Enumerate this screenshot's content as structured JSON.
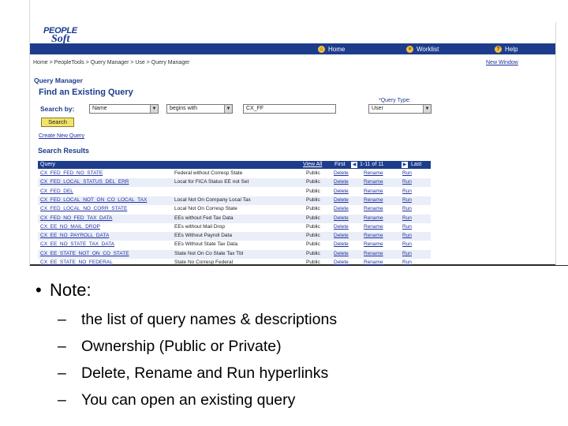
{
  "app": {
    "logo_top": "PEOPLE",
    "logo_bottom": "Soft"
  },
  "topnav": {
    "home": "Home",
    "worklist": "Worklist",
    "help": "Help"
  },
  "breadcrumb": "Home > PeopleTools > Query Manager > Use > Query Manager",
  "new_window": "New Window",
  "page": {
    "section_title": "Query Manager",
    "title": "Find an Existing Query"
  },
  "search": {
    "label": "Search by:",
    "field_value": "Name",
    "operator_value": "begins with",
    "input_value": "CX_FF",
    "query_type_label": "*Query Type:",
    "query_type_value": "User",
    "button_label": "Search",
    "create_link": "Create New Query"
  },
  "results": {
    "title": "Search Results",
    "headers": {
      "query": "Query",
      "view_all": "View All",
      "first": "First",
      "range": "1-11 of 11",
      "last": "Last"
    },
    "rows": [
      {
        "name": "CX_FED_FED_NO_STATE",
        "desc": "Federal without Corresp State",
        "owner": "Public",
        "delete": "Delete",
        "rename": "Rename",
        "run": "Run"
      },
      {
        "name": "CX_FED_LOCAL_STATUS_DEL_ERR",
        "desc": "Local for FICA Status EE not Set",
        "owner": "Public",
        "delete": "Delete",
        "rename": "Rename",
        "run": "Run"
      },
      {
        "name": "CX_FED_DEL",
        "desc": "",
        "owner": "Public",
        "delete": "Delete",
        "rename": "Rename",
        "run": "Run"
      },
      {
        "name": "CX_FED_LOCAL_NOT_ON_CO_LOCAL_TAX",
        "desc": "Local Not On Company Local Tax",
        "owner": "Public",
        "delete": "Delete",
        "rename": "Rename",
        "run": "Run"
      },
      {
        "name": "CX_FED_LOCAL_NO_CORR_STATE",
        "desc": "Local Not On Corresp State",
        "owner": "Public",
        "delete": "Delete",
        "rename": "Rename",
        "run": "Run"
      },
      {
        "name": "CX_FED_NO_FED_TAX_DATA",
        "desc": "EEs without Fed Tax Data",
        "owner": "Public",
        "delete": "Delete",
        "rename": "Rename",
        "run": "Run"
      },
      {
        "name": "CX_EE_NO_MAIL_DROP",
        "desc": "EEs without Mail Drop",
        "owner": "Public",
        "delete": "Delete",
        "rename": "Rename",
        "run": "Run"
      },
      {
        "name": "CX_EE_NO_PAYROLL_DATA",
        "desc": "EEs Without Payroll Data",
        "owner": "Public",
        "delete": "Delete",
        "rename": "Rename",
        "run": "Run"
      },
      {
        "name": "CX_EE_NO_STATE_TAX_DATA",
        "desc": "EEs Without State Tax Data",
        "owner": "Public",
        "delete": "Delete",
        "rename": "Rename",
        "run": "Run"
      },
      {
        "name": "CX_EE_STATE_NOT_ON_CO_STATE",
        "desc": "State Not On Co State Tax Tbl",
        "owner": "Public",
        "delete": "Delete",
        "rename": "Rename",
        "run": "Run"
      },
      {
        "name": "CX_EE_STATE_NO_FEDERAL",
        "desc": "State No Corresp Federal",
        "owner": "Public",
        "delete": "Delete",
        "rename": "Rename",
        "run": "Run"
      }
    ]
  },
  "slide": {
    "note": "Note:",
    "bullets": [
      "the list of query names & descriptions",
      "Ownership (Public or Private)",
      "Delete, Rename and Run hyperlinks",
      "You can open an existing query"
    ]
  }
}
